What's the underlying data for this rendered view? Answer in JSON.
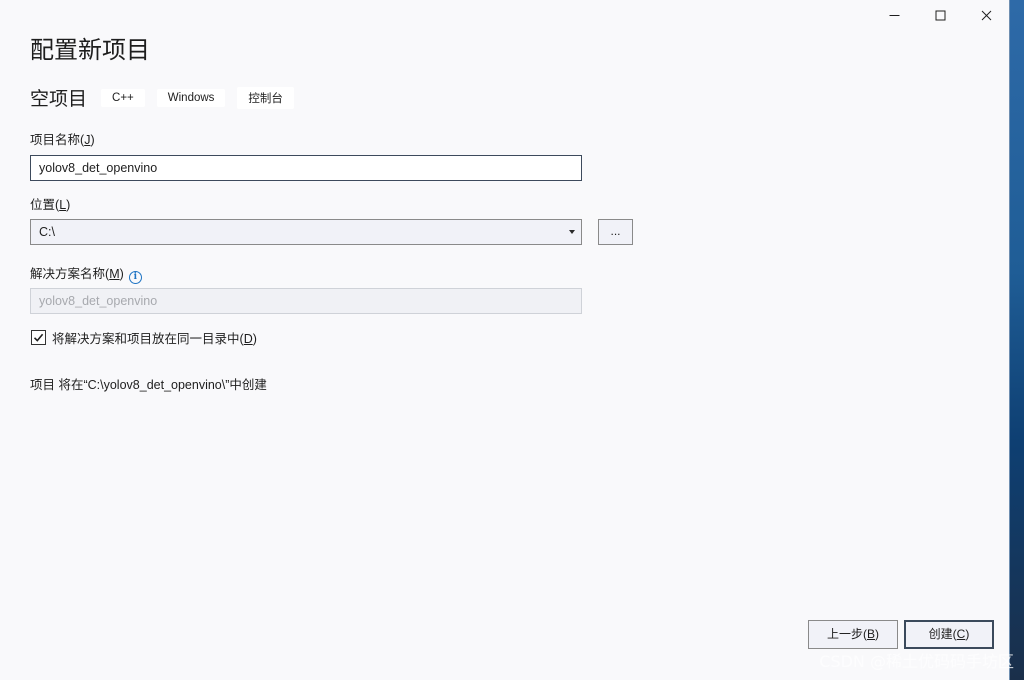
{
  "window": {
    "controls": {
      "minimize": "minimize-icon",
      "maximize": "maximize-icon",
      "close": "close-icon"
    },
    "title": "配置新项目"
  },
  "template": {
    "name": "空项目",
    "tags": [
      "C++",
      "Windows",
      "控制台"
    ]
  },
  "project_name": {
    "label": "项目名称",
    "accel": "J",
    "value": "yolov8_det_openvino"
  },
  "location": {
    "label": "位置",
    "accel": "L",
    "value": "C:\\",
    "browse_label": "..."
  },
  "solution_name": {
    "label": "解决方案名称",
    "accel": "M",
    "info_icon": "info-icon",
    "value": "yolov8_det_openvino"
  },
  "same_dir": {
    "checked": true,
    "label": "将解决方案和项目放在同一目录中",
    "accel": "D"
  },
  "summary": "项目 将在“C:\\yolov8_det_openvino\\”中创建",
  "buttons": {
    "back": {
      "label": "上一步",
      "accel": "B"
    },
    "create": {
      "label": "创建",
      "accel": "C"
    }
  },
  "watermark": "CSDN @稀土优码码手坊区"
}
